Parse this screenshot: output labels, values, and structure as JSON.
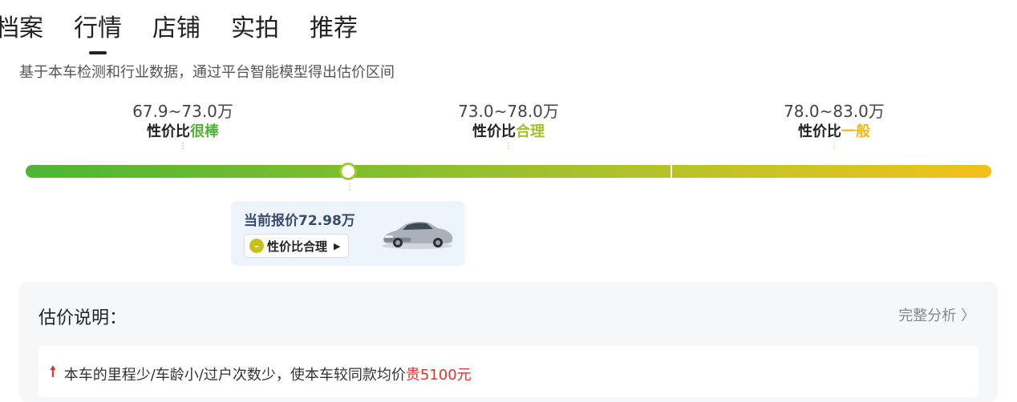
{
  "tabs": [
    {
      "label": "档案",
      "active": false
    },
    {
      "label": "行情",
      "active": true
    },
    {
      "label": "店铺",
      "active": false
    },
    {
      "label": "实拍",
      "active": false
    },
    {
      "label": "推荐",
      "active": false
    }
  ],
  "subtitle": "基于本车检测和行业数据，通过平台智能模型得出估价区间",
  "ranges": [
    {
      "price": "67.9~73.0万",
      "verdict_prefix": "性价比",
      "verdict": "很棒",
      "color": "#4eb534"
    },
    {
      "price": "73.0~78.0万",
      "verdict_prefix": "性价比",
      "verdict": "合理",
      "color": "#a3c12a"
    },
    {
      "price": "78.0~83.0万",
      "verdict_prefix": "性价比",
      "verdict": "一般",
      "color": "#e9b91a"
    }
  ],
  "current": {
    "label": "当前报价72.98万",
    "tag": "性价比合理",
    "tag_icon": "neutral-face-icon",
    "car_icon": "car-icon",
    "marker_position": 0.336
  },
  "explain": {
    "title": "估价说明：",
    "link": "完整分析",
    "item_prefix": "本车的里程少/车龄小/过户次数少，使本车较同款均价",
    "item_highlight": "贵5100元",
    "item_icon": "up-arrow-icon"
  }
}
